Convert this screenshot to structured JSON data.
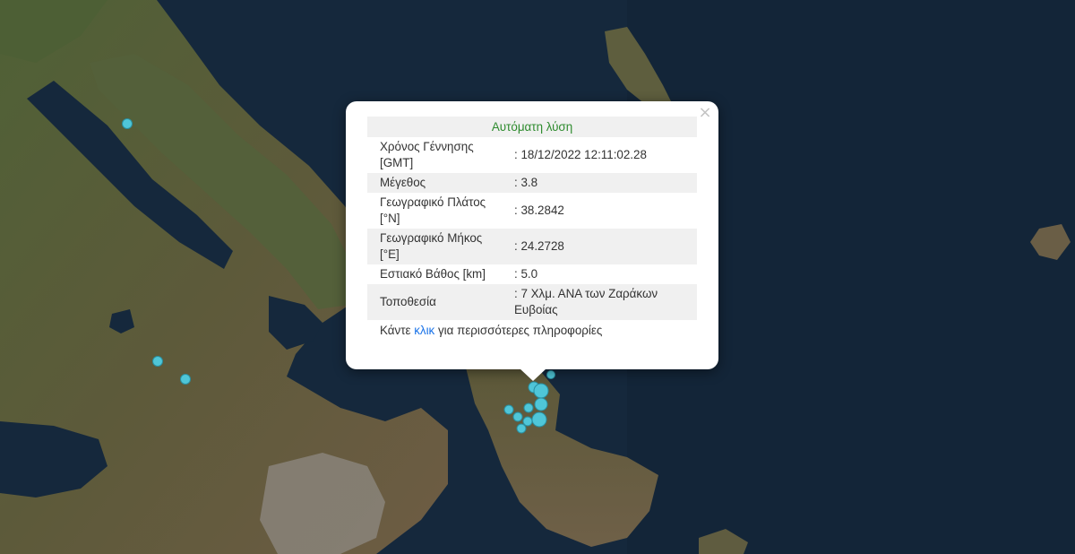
{
  "popup": {
    "header": "Αυτόματη λύση",
    "close_symbol": "×",
    "rows": [
      {
        "label_line1": "Χρόνος Γέννησης",
        "label_line2": "[GMT]",
        "value_line1": ": 18/12/2022 12:11:02.28",
        "value_line2": ""
      },
      {
        "label_line1": "Μέγεθος",
        "label_line2": "",
        "value_line1": ": 3.8",
        "value_line2": ""
      },
      {
        "label_line1": "Γεωγραφικό Πλάτος",
        "label_line2": "[°N]",
        "value_line1": ": 38.2842",
        "value_line2": ""
      },
      {
        "label_line1": "Γεωγραφικό Μήκος",
        "label_line2": "[°E]",
        "value_line1": ": 24.2728",
        "value_line2": ""
      },
      {
        "label_line1": "Εστιακό Βάθος [km]",
        "label_line2": "",
        "value_line1": ": 5.0",
        "value_line2": ""
      },
      {
        "label_line1": "Τοποθεσία",
        "label_line2": "",
        "value_line1": ": 7 Χλμ. ΑΝΑ των Ζαράκων",
        "value_line2": "Ευβοίας"
      }
    ],
    "footer_before": "Κάντε ",
    "footer_link": "κλικ",
    "footer_after": " για περισσότερες πληροφορίες"
  },
  "colors": {
    "sea": "#14263a",
    "land_green": "#4c5e34",
    "land_brown": "#6b5a42",
    "urban": "#8a847a",
    "marker": "#4fc6d8",
    "header_text": "#2e8b2e",
    "link": "#1a73e8"
  }
}
